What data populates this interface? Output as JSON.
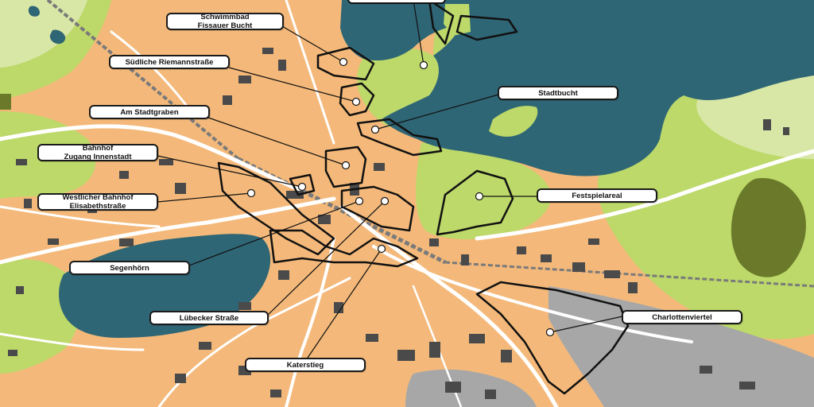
{
  "map": {
    "colors": {
      "water": "#2f6675",
      "urban": "#f4b97a",
      "green": "#bcd96a",
      "green_light": "#d9e7a6",
      "forest": "#6b7a2a",
      "industrial": "#a7a7a7",
      "building": "#4a4a4a",
      "road": "#ffffff",
      "railway": "#8a8a8a",
      "boundary": "#111111"
    },
    "labels": [
      {
        "id": "schwimmbad",
        "lines": [
          "Schwimmbad",
          "Fissauer Bucht"
        ]
      },
      {
        "id": "riemann",
        "lines": [
          "Südliche Riemannstraße"
        ]
      },
      {
        "id": "stadtgraben",
        "lines": [
          "Am Stadtgraben"
        ]
      },
      {
        "id": "bahnhof-innenstadt",
        "lines": [
          "Bahnhof",
          "Zugang Innenstadt"
        ]
      },
      {
        "id": "westlicher-bahnhof",
        "lines": [
          "Westlicher Bahnhof",
          "Elisabethstraße"
        ]
      },
      {
        "id": "segenhoern",
        "lines": [
          "Segenhörn"
        ]
      },
      {
        "id": "luebecker",
        "lines": [
          "Lübecker Straße"
        ]
      },
      {
        "id": "katerstieg",
        "lines": [
          "Katerstieg"
        ]
      },
      {
        "id": "stadtbucht",
        "lines": [
          "Stadtbucht"
        ]
      },
      {
        "id": "festspielareal",
        "lines": [
          "Festspielareal"
        ]
      },
      {
        "id": "charlottenviertel",
        "lines": [
          "Charlottenviertel"
        ]
      }
    ]
  }
}
